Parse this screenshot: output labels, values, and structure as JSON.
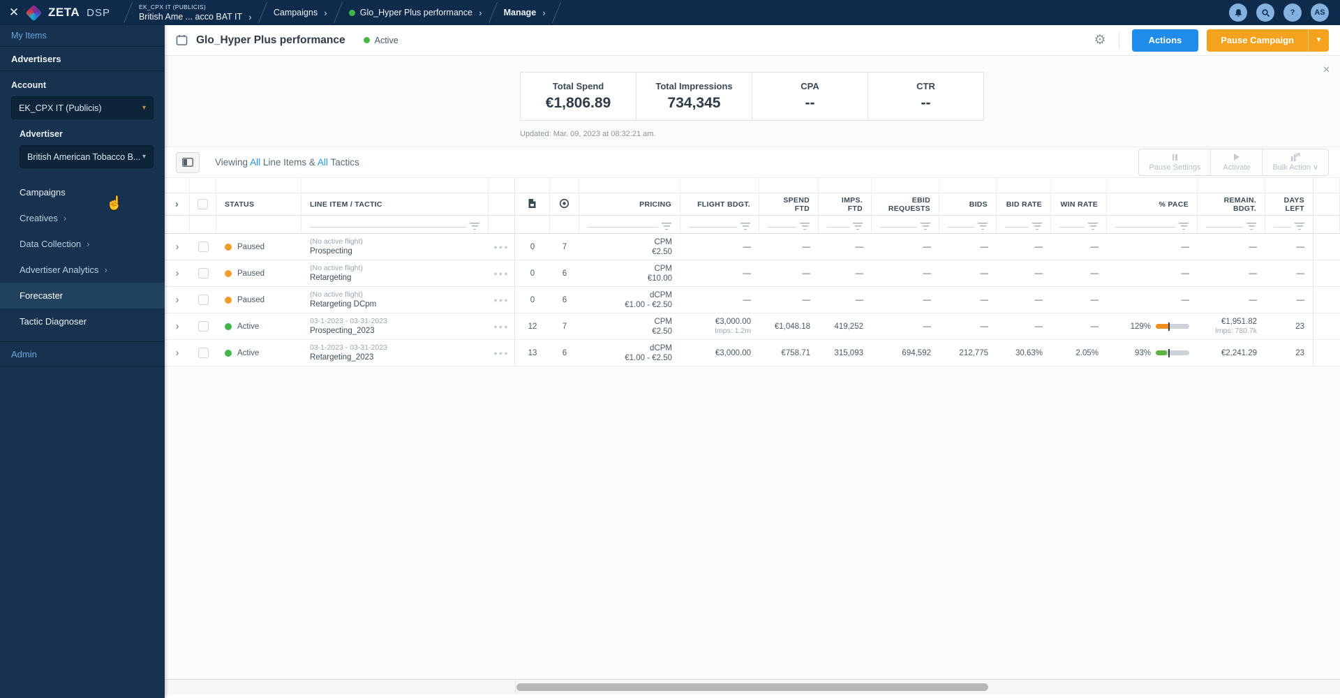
{
  "colors": {
    "accent": "#1f8ceb",
    "orange_button": "#f5a21f",
    "paused": "#f09d2e",
    "active": "#43b64a",
    "pace_orange": "#ef8d1f",
    "pace_green": "#5cb245"
  },
  "topbar": {
    "brand": "ZETA",
    "brand_suffix": "DSP",
    "breadcrumbs": [
      {
        "eyebrow": "EK_CPX IT (PUBLICIS)",
        "label": "British Ame ... acco BAT IT"
      },
      {
        "label": "Campaigns"
      },
      {
        "label": "Glo_Hyper Plus performance",
        "dot": true
      },
      {
        "label": "Manage",
        "bold": true
      }
    ],
    "avatar": "AS"
  },
  "sidebar": {
    "my_items": "My Items",
    "advertisers": "Advertisers",
    "account_label": "Account",
    "account_value": "EK_CPX IT (Publicis)",
    "advertiser_label": "Advertiser",
    "advertiser_value": "British American Tobacco B...",
    "nav": [
      {
        "label": "Campaigns",
        "bright": true
      },
      {
        "label": "Creatives",
        "arrow": true
      },
      {
        "label": "Data Collection",
        "arrow": true
      },
      {
        "label": "Advertiser Analytics",
        "arrow": true
      },
      {
        "label": "Forecaster",
        "active": true
      },
      {
        "label": "Tactic Diagnoser",
        "bright": true
      }
    ],
    "admin": "Admin"
  },
  "header": {
    "title": "Glo_Hyper Plus performance",
    "status": "Active",
    "actions_label": "Actions",
    "pause_label": "Pause Campaign"
  },
  "summary": {
    "stats": [
      {
        "label": "Total Spend",
        "value": "€1,806.89"
      },
      {
        "label": "Total Impressions",
        "value": "734,345"
      },
      {
        "label": "CPA",
        "value": "--"
      },
      {
        "label": "CTR",
        "value": "--"
      }
    ],
    "updated": "Updated: Mar. 09, 2023 at 08:32:21 am."
  },
  "toolbar": {
    "viewing_prefix": "Viewing",
    "all_1": "All",
    "mid": "Line Items &",
    "all_2": "All",
    "suffix": "Tactics",
    "bulk_buttons": [
      {
        "label": "Pause Settings"
      },
      {
        "label": "Activate"
      },
      {
        "label": "Bulk Action ∨"
      }
    ]
  },
  "table": {
    "columns": {
      "status": "STATUS",
      "lineitem": "LINE ITEM / TACTIC",
      "pricing": "PRICING",
      "flight": "FLIGHT BDGT.",
      "spend": "SPEND\nFTD",
      "imps": "IMPS. FTD",
      "ebid": "EBID\nREQUESTS",
      "bids": "BIDS",
      "bidrate": "BID RATE",
      "winrate": "WIN RATE",
      "pace": "% PACE",
      "remain": "REMAIN.\nBDGT.",
      "days": "DAYS\nLEFT"
    },
    "rows": [
      {
        "status": "Paused",
        "statusKey": "paused",
        "flightNote": "(No active flight)",
        "name": "Prospecting",
        "creatives": "0",
        "tactics": "7",
        "pricingModel": "CPM",
        "pricingValue": "€2.50",
        "flight": "—",
        "flightSub": "",
        "spend": "—",
        "imps": "—",
        "ebid": "—",
        "bids": "—",
        "bidRate": "—",
        "winRate": "—",
        "paceLabel": "—",
        "paceBar": null,
        "remain": "—",
        "remainSub": "",
        "days": "—"
      },
      {
        "status": "Paused",
        "statusKey": "paused",
        "flightNote": "(No active flight)",
        "name": "Retargeting",
        "creatives": "0",
        "tactics": "6",
        "pricingModel": "CPM",
        "pricingValue": "€10.00",
        "flight": "—",
        "flightSub": "",
        "spend": "—",
        "imps": "—",
        "ebid": "—",
        "bids": "—",
        "bidRate": "—",
        "winRate": "—",
        "paceLabel": "—",
        "paceBar": null,
        "remain": "—",
        "remainSub": "",
        "days": "—"
      },
      {
        "status": "Paused",
        "statusKey": "paused",
        "flightNote": "(No active flight)",
        "name": "Retargeting DCpm",
        "creatives": "0",
        "tactics": "6",
        "pricingModel": "dCPM",
        "pricingValue": "€1.00 - €2.50",
        "flight": "—",
        "flightSub": "",
        "spend": "—",
        "imps": "—",
        "ebid": "—",
        "bids": "—",
        "bidRate": "—",
        "winRate": "—",
        "paceLabel": "—",
        "paceBar": null,
        "remain": "—",
        "remainSub": "",
        "days": "—"
      },
      {
        "status": "Active",
        "statusKey": "active",
        "flightNote": "03-1-2023 - 03-31-2023",
        "name": "Prospecting_2023",
        "creatives": "12",
        "tactics": "7",
        "pricingModel": "CPM",
        "pricingValue": "€2.50",
        "flight": "€3,000.00",
        "flightSub": "Imps: 1.2m",
        "spend": "€1,048.18",
        "imps": "419,252",
        "ebid": "—",
        "bids": "—",
        "bidRate": "—",
        "winRate": "—",
        "paceLabel": "129%",
        "paceBar": {
          "fill": 42,
          "marker": 38,
          "color": "pace_orange"
        },
        "remain": "€1,951.82",
        "remainSub": "Imps: 780.7k",
        "days": "23"
      },
      {
        "status": "Active",
        "statusKey": "active",
        "flightNote": "03-1-2023 - 03-31-2023",
        "name": "Retargeting_2023",
        "creatives": "13",
        "tactics": "6",
        "pricingModel": "dCPM",
        "pricingValue": "€1.00 - €2.50",
        "flight": "€3,000.00",
        "flightSub": "",
        "spend": "€758.71",
        "imps": "315,093",
        "ebid": "694,592",
        "bids": "212,775",
        "bidRate": "30.63%",
        "winRate": "2.05%",
        "paceLabel": "93%",
        "paceBar": {
          "fill": 33,
          "marker": 38,
          "color": "pace_green"
        },
        "remain": "€2,241.29",
        "remainSub": "",
        "days": "23"
      }
    ]
  }
}
